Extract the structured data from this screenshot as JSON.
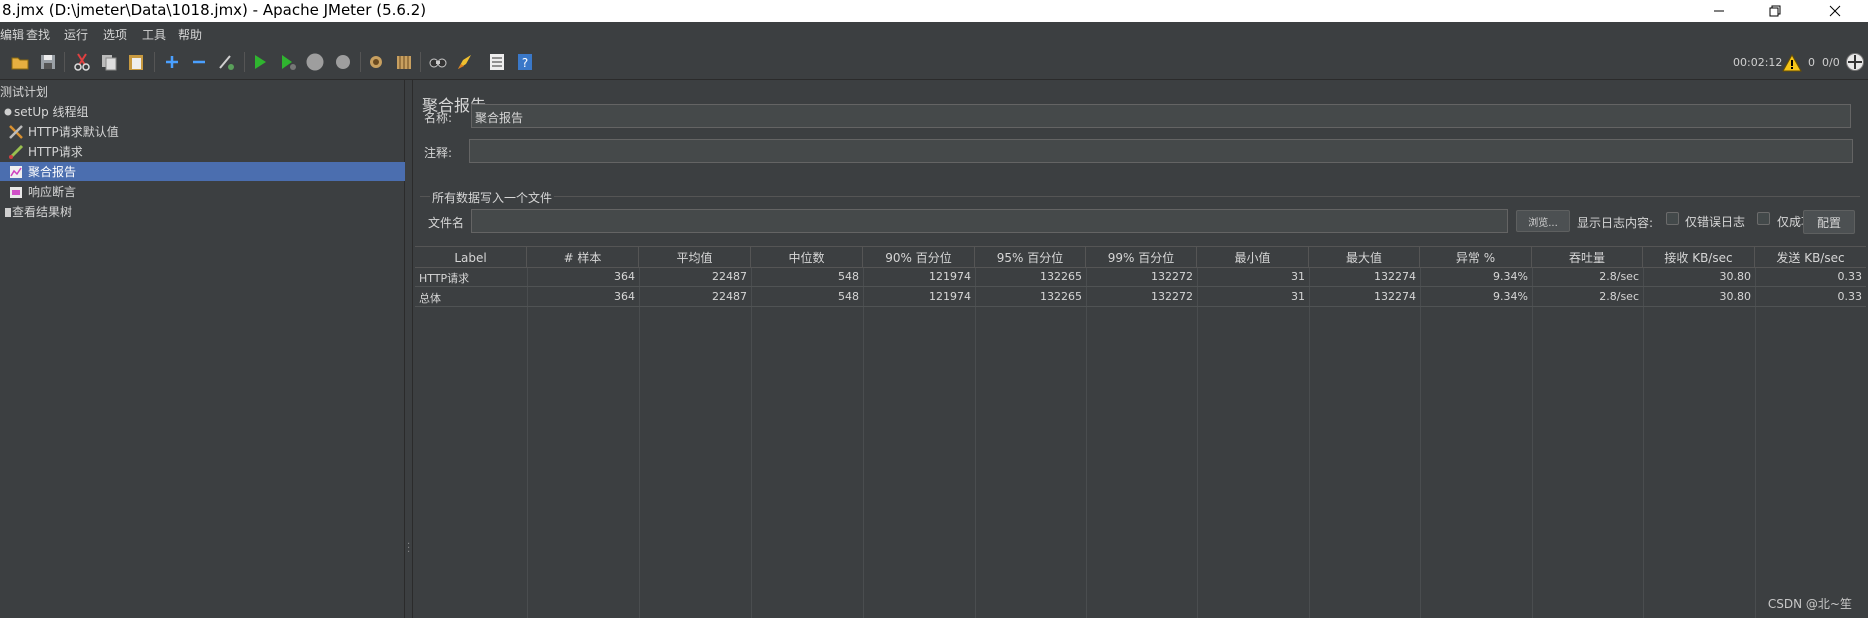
{
  "window": {
    "title": "8.jmx (D:\\jmeter\\Data\\1018.jmx) - Apache JMeter (5.6.2)"
  },
  "menu": [
    "编辑",
    "查找",
    "运行",
    "选项",
    "工具",
    "帮助"
  ],
  "toolbar": {
    "icons": [
      "open-icon",
      "save-icon",
      "cut-icon",
      "copy-icon",
      "paste-icon",
      "expand-icon",
      "collapse-icon",
      "toggle-icon",
      "start-icon",
      "start-no-pause-icon",
      "stop-icon",
      "shutdown-icon",
      "clear-icon",
      "clear-all-icon",
      "search-icon",
      "reset-search-icon",
      "function-helper-icon",
      "help-icon"
    ],
    "elapsed_time": "00:02:12",
    "warning_count": "0",
    "threads": "0/0"
  },
  "tree": {
    "items": [
      {
        "label": "测试计划",
        "icon": "test-plan-icon",
        "selected": false
      },
      {
        "label": "setUp 线程组",
        "icon": "thread-group-icon",
        "selected": false
      },
      {
        "label": "HTTP请求默认值",
        "icon": "config-icon",
        "selected": false
      },
      {
        "label": "HTTP请求",
        "icon": "sampler-icon",
        "selected": false
      },
      {
        "label": "聚合报告",
        "icon": "report-icon",
        "selected": true
      },
      {
        "label": "响应断言",
        "icon": "assertion-icon",
        "selected": false
      },
      {
        "label": "查看结果树",
        "icon": "listener-icon",
        "selected": false
      }
    ]
  },
  "panel": {
    "title": "聚合报告",
    "name_label": "名称:",
    "name_value": "聚合报告",
    "comment_label": "注释:",
    "comment_value": "",
    "file_section": "所有数据写入一个文件",
    "filename_label": "文件名",
    "filename_value": "",
    "browse_button": "浏览...",
    "log_contents_label": "显示日志内容:",
    "errors_only_label": "仅错误日志",
    "success_only_label": "仅成功日志",
    "configure_button": "配置"
  },
  "table": {
    "headers": [
      "Label",
      "# 样本",
      "平均值",
      "中位数",
      "90% 百分位",
      "95% 百分位",
      "99% 百分位",
      "最小值",
      "最大值",
      "异常 %",
      "吞吐量",
      "接收 KB/sec",
      "发送 KB/sec"
    ],
    "rows": [
      [
        "HTTP请求",
        "364",
        "22487",
        "548",
        "121974",
        "132265",
        "132272",
        "31",
        "132274",
        "9.34%",
        "2.8/sec",
        "30.80",
        "0.33"
      ],
      [
        "总体",
        "364",
        "22487",
        "548",
        "121974",
        "132265",
        "132272",
        "31",
        "132274",
        "9.34%",
        "2.8/sec",
        "30.80",
        "0.33"
      ]
    ]
  },
  "watermark": "CSDN @北~笙"
}
